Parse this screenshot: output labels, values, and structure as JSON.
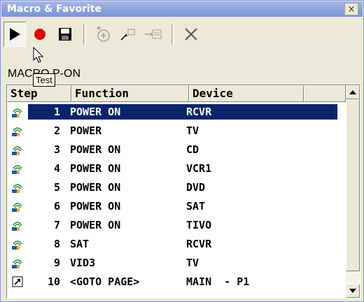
{
  "window": {
    "title": "Macro & Favorite",
    "close_label": "×"
  },
  "toolbar": {
    "tooltip": "Test",
    "buttons": [
      "play-icon",
      "record-icon",
      "save-icon",
      "add-icon",
      "insert-icon",
      "move-icon",
      "delete-icon"
    ]
  },
  "macro": {
    "name": "MACRO P-ON"
  },
  "table": {
    "headers": {
      "step": "Step",
      "function": "Function",
      "device": "Device"
    },
    "rows": [
      {
        "step": "1",
        "function": "POWER ON",
        "device": "RCVR",
        "icon": "ir-remote-icon",
        "selected": true
      },
      {
        "step": "2",
        "function": "POWER",
        "device": "TV",
        "icon": "ir-remote-icon"
      },
      {
        "step": "3",
        "function": "POWER ON",
        "device": "CD",
        "icon": "ir-remote-icon"
      },
      {
        "step": "4",
        "function": "POWER ON",
        "device": "VCR1",
        "icon": "ir-remote-icon"
      },
      {
        "step": "5",
        "function": "POWER ON",
        "device": "DVD",
        "icon": "ir-remote-icon"
      },
      {
        "step": "6",
        "function": "POWER ON",
        "device": "SAT",
        "icon": "ir-remote-icon"
      },
      {
        "step": "7",
        "function": "POWER ON",
        "device": "TIVO",
        "icon": "ir-remote-icon"
      },
      {
        "step": "8",
        "function": "SAT",
        "device": "RCVR",
        "icon": "ir-remote-icon"
      },
      {
        "step": "9",
        "function": "VID3",
        "device": "TV",
        "icon": "ir-remote-icon"
      },
      {
        "step": "10",
        "function": "<GOTO PAGE>",
        "device": "MAIN  - P1",
        "icon": "shortcut-icon"
      }
    ]
  },
  "colors": {
    "selection": "#0a246a",
    "record": "#e00000"
  }
}
